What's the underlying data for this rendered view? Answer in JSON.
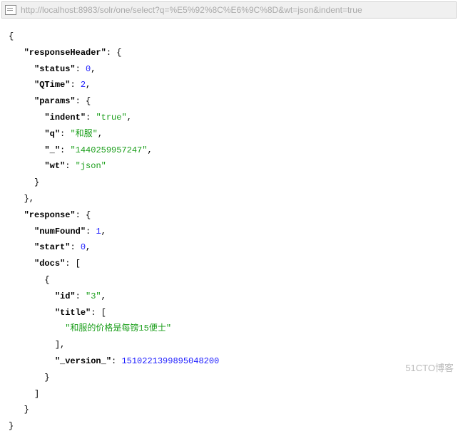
{
  "url": "http://localhost:8983/solr/one/select?q=%E5%92%8C%E6%9C%8D&wt=json&indent=true",
  "watermark": "51CTO博客",
  "json": {
    "openBrace": "{",
    "closeBrace": "}",
    "responseHeader": {
      "key": "\"responseHeader\"",
      "open": "{",
      "status_key": "\"status\"",
      "status_val": "0",
      "qtime_key": "\"QTime\"",
      "qtime_val": "2",
      "params_key": "\"params\"",
      "params_open": "{",
      "indent_key": "\"indent\"",
      "indent_val": "\"true\"",
      "q_key": "\"q\"",
      "q_val": "\"和服\"",
      "us_key": "\"_\"",
      "us_val": "\"1440259957247\"",
      "wt_key": "\"wt\"",
      "wt_val": "\"json\"",
      "params_close": "}",
      "close": "},"
    },
    "response": {
      "key": "\"response\"",
      "open": "{",
      "numFound_key": "\"numFound\"",
      "numFound_val": "1",
      "start_key": "\"start\"",
      "start_val": "0",
      "docs_key": "\"docs\"",
      "docs_open": "[",
      "doc_open": "{",
      "id_key": "\"id\"",
      "id_val": "\"3\"",
      "title_key": "\"title\"",
      "title_open": "[",
      "title_val": "\"和服的价格是每镑15便士\"",
      "title_close": "],",
      "version_key": "\"_version_\"",
      "version_val": "1510221399895048200",
      "doc_close": "}",
      "docs_close": "]",
      "close": "}"
    }
  }
}
